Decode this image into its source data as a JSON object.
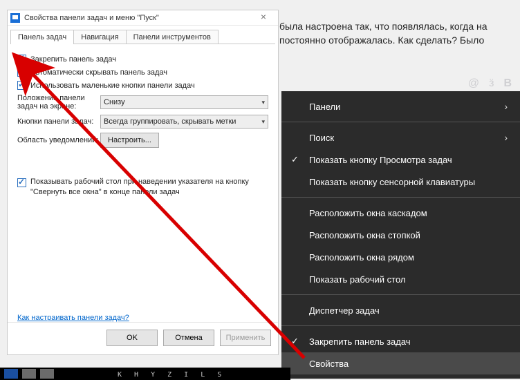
{
  "background_text": "была настроена так, что появлялась, когда на постоянно отображалась. Как сделать? Было",
  "dialog": {
    "title": "Свойства панели задач и меню \"Пуск\"",
    "tabs": {
      "t1": "Панель задач",
      "t2": "Навигация",
      "t3": "Панели инструментов"
    },
    "checks": {
      "lock": "Закрепить панель задач",
      "autohide": "Автоматически скрывать панель задач",
      "smallbtns": "Использовать маленькие кнопки панели задач",
      "showdesktop": "Показывать рабочий стол при наведении указателя на кнопку \"Свернуть все окна\" в конце панели задач"
    },
    "labels": {
      "position": "Положение панели задач на экране:",
      "buttons": "Кнопки панели задач:",
      "notif": "Область уведомлений:"
    },
    "selects": {
      "position_val": "Снизу",
      "buttons_val": "Всегда группировать, скрывать метки"
    },
    "configure_btn": "Настроить...",
    "help_link": "Как настраивать панели задач?",
    "footer": {
      "ok": "OK",
      "cancel": "Отмена",
      "apply": "Применить"
    }
  },
  "ctx": {
    "panels": "Панели",
    "search": "Поиск",
    "taskview": "Показать кнопку Просмотра задач",
    "touchkb": "Показать кнопку сенсорной клавиатуры",
    "cascade": "Расположить окна каскадом",
    "stack": "Расположить окна стопкой",
    "side": "Расположить окна рядом",
    "showdesk": "Показать рабочий стол",
    "taskmgr": "Диспетчер задач",
    "lock": "Закрепить панель задач",
    "props": "Свойства"
  },
  "taskbar_text": "K H Y Z I L   S"
}
